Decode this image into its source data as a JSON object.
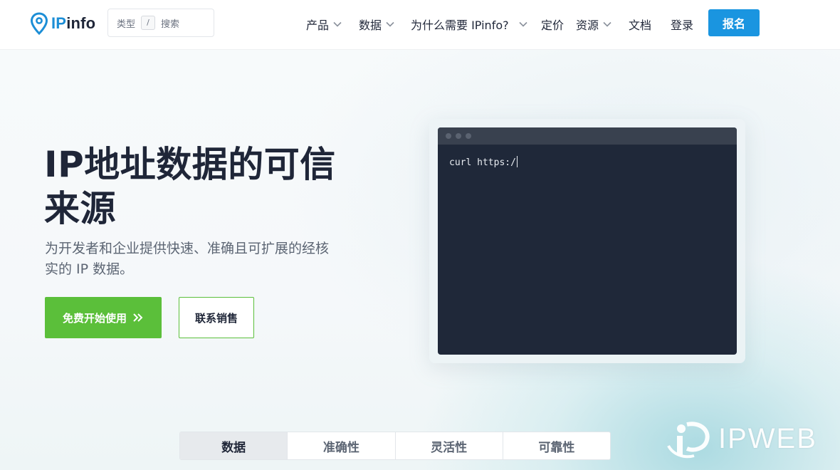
{
  "header": {
    "logo_prefix": "IP",
    "logo_suffix": "info",
    "search": {
      "type_label": "类型",
      "slash_key": "/",
      "search_label": "搜索"
    },
    "nav": [
      {
        "label": "产品",
        "dropdown": true
      },
      {
        "label": "数据",
        "dropdown": true
      },
      {
        "label": "为什么需要 IPinfo?",
        "dropdown": true
      },
      {
        "label": "定价",
        "dropdown": false
      },
      {
        "label": "资源",
        "dropdown": true
      },
      {
        "label": "文档",
        "dropdown": false
      },
      {
        "label": "登录",
        "dropdown": false
      }
    ],
    "signup_label": "报名"
  },
  "hero": {
    "title_line1": "IP地址数据的可信",
    "title_line2": "来源",
    "subtitle_line1": "为开发者和企业提供快速、准确且可扩展的经核",
    "subtitle_line2": "实的 IP 数据。",
    "primary_button": "免费开始使用",
    "primary_button_icon": "double-chevron-right-icon",
    "secondary_button": "联系销售"
  },
  "terminal": {
    "command": "curl https:/"
  },
  "tabs": [
    {
      "label": "数据",
      "active": true
    },
    {
      "label": "准确性",
      "active": false
    },
    {
      "label": "灵活性",
      "active": false
    },
    {
      "label": "可靠性",
      "active": false
    }
  ],
  "watermark": {
    "text": "IPWEB"
  },
  "colors": {
    "brand_blue": "#1a95e0",
    "cta_green": "#5bbf3a",
    "text_dark": "#1f2638",
    "terminal_bg": "#1f2839"
  }
}
